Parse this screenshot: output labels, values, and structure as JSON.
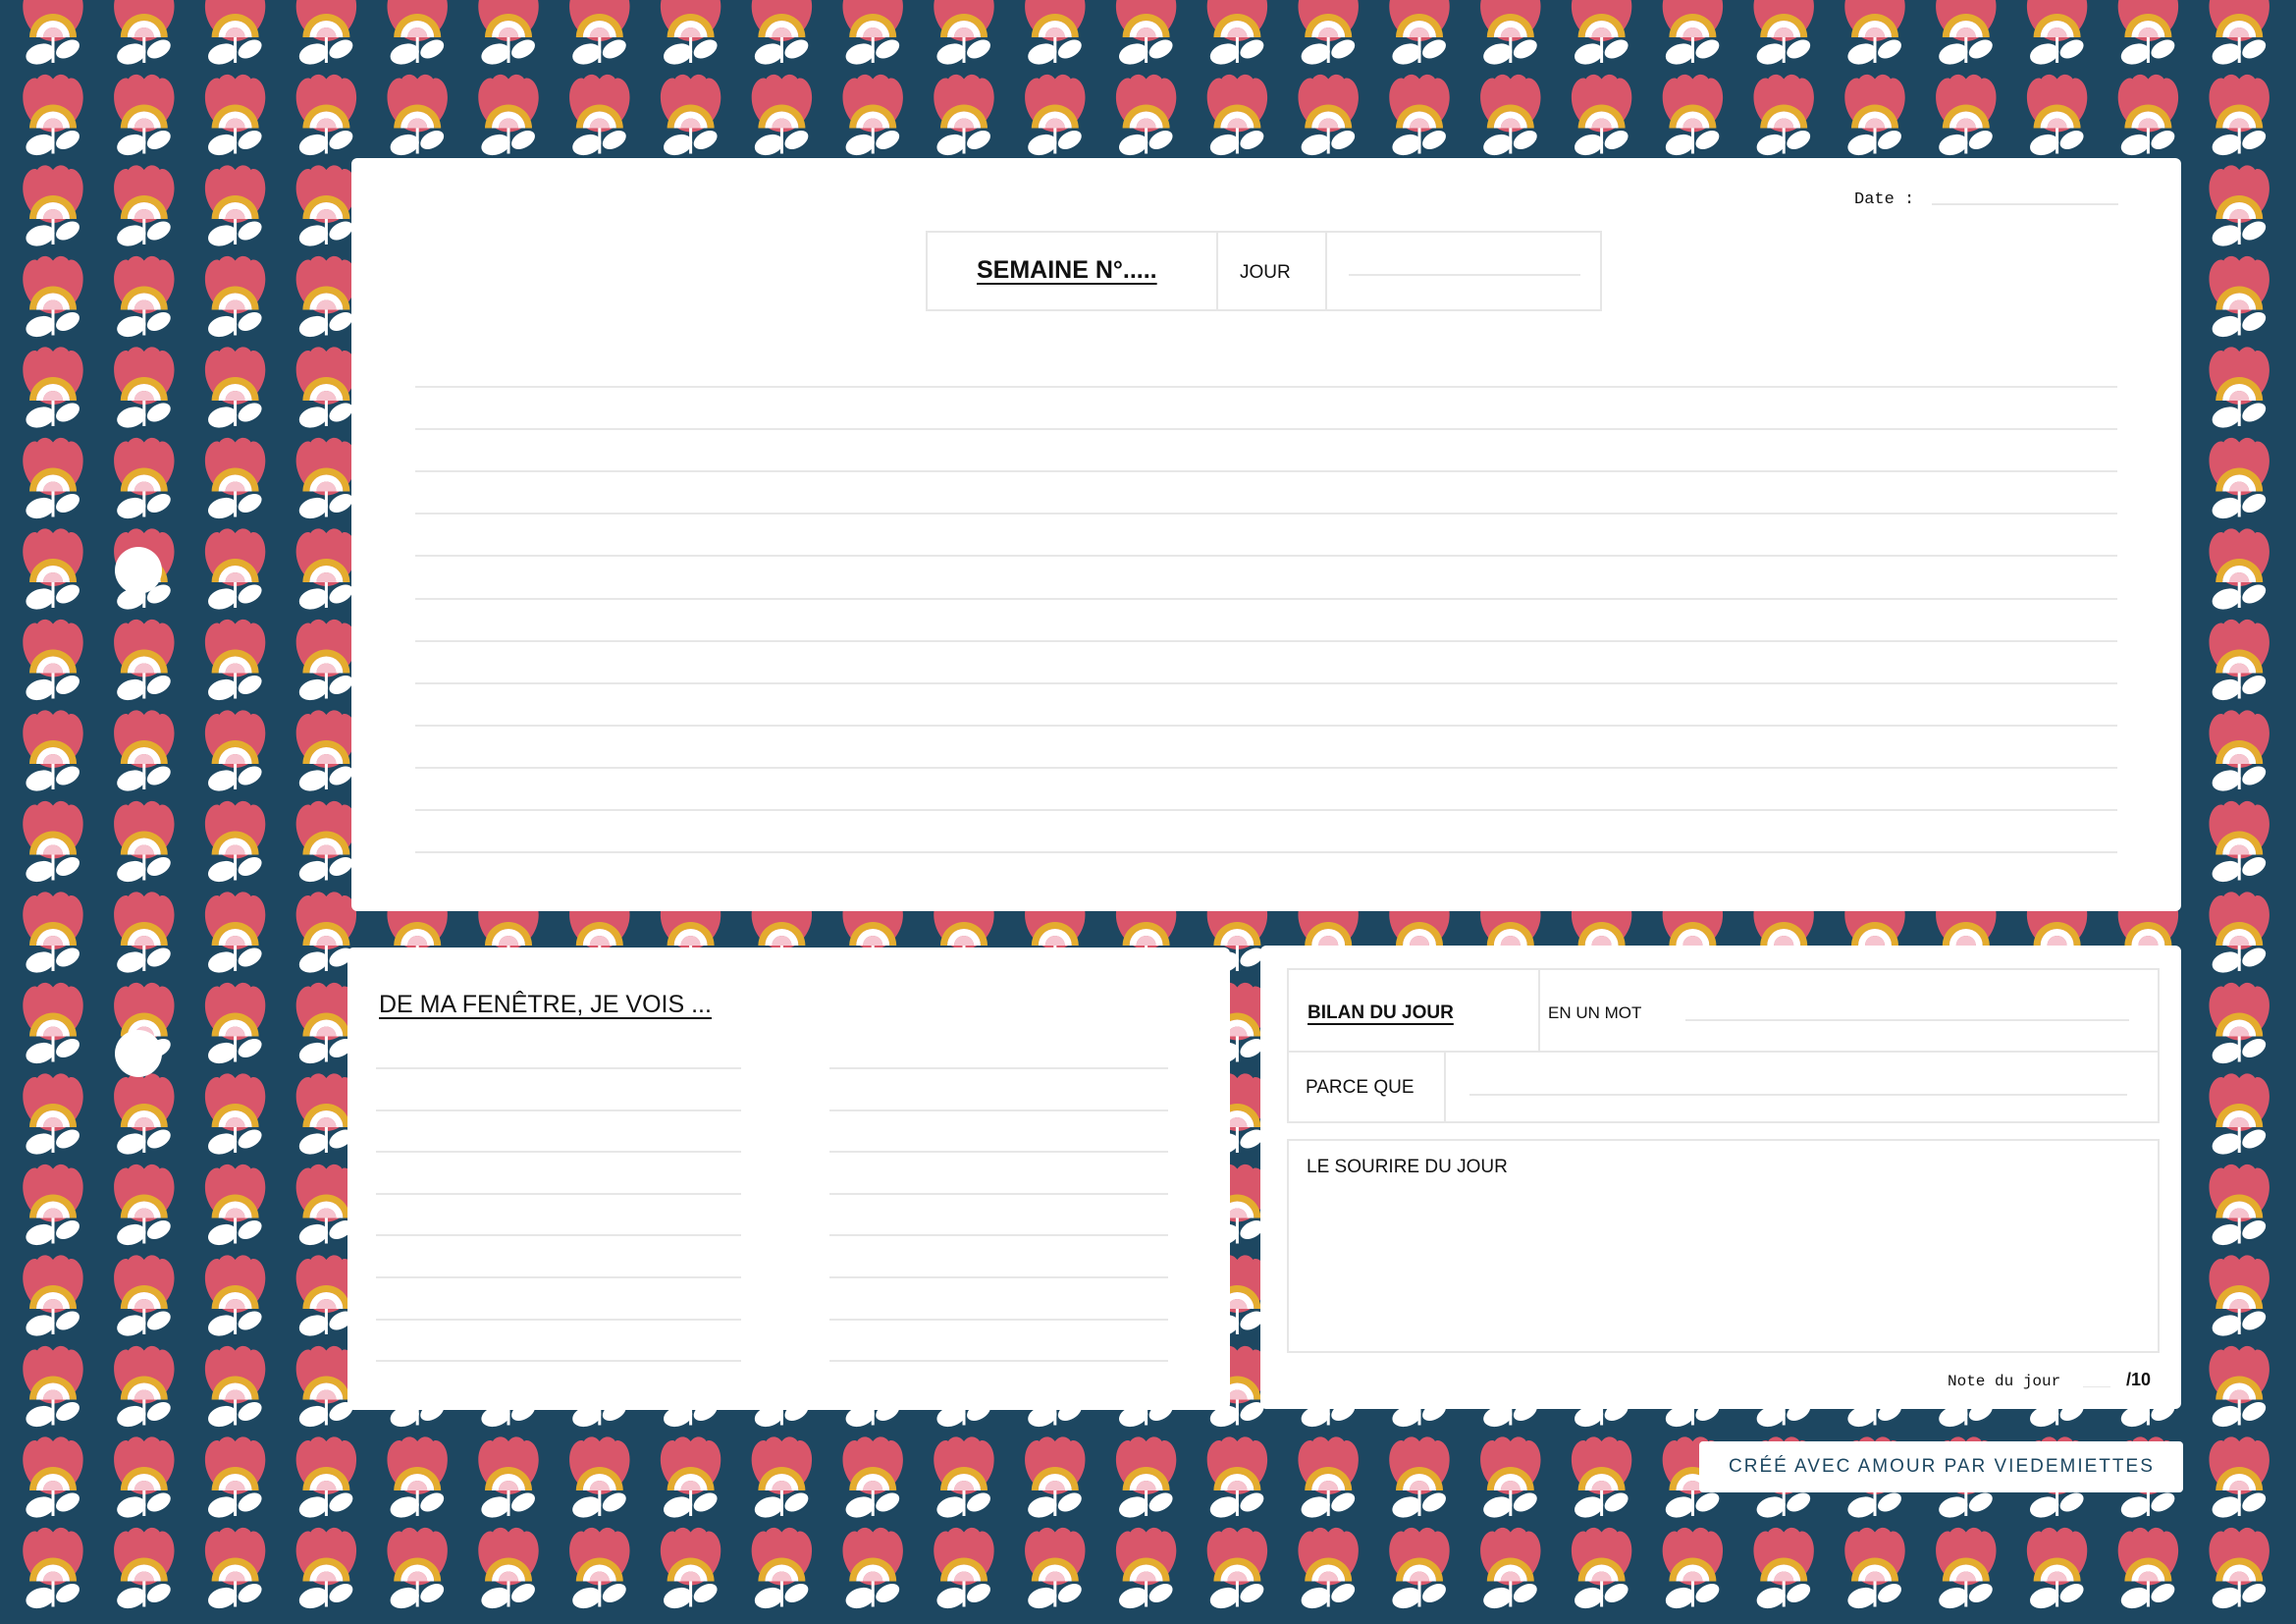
{
  "page": {
    "background_color": "#1d4761",
    "pattern_icon": "tulip-icon",
    "pattern_colors": {
      "petal": "#d9566a",
      "arc_gold": "#e4ac2e",
      "arc_pink": "#f6c4cf",
      "leaf": "#ffffff"
    }
  },
  "main_card": {
    "date_label": "Date :",
    "week_label": "SEMAINE N°.....",
    "day_label": "JOUR"
  },
  "window_card": {
    "title": "DE MA FENÊTRE, JE VOIS ..."
  },
  "bilan_card": {
    "title": "BILAN DU JOUR",
    "one_word_label": "EN UN MOT",
    "because_label": "PARCE QUE",
    "smile_label": "LE SOURIRE DU JOUR",
    "note_label": "Note du jour",
    "note_max": "/10"
  },
  "footer": {
    "credit": "CRÉÉ AVEC AMOUR PAR VIEDEMIETTES"
  }
}
